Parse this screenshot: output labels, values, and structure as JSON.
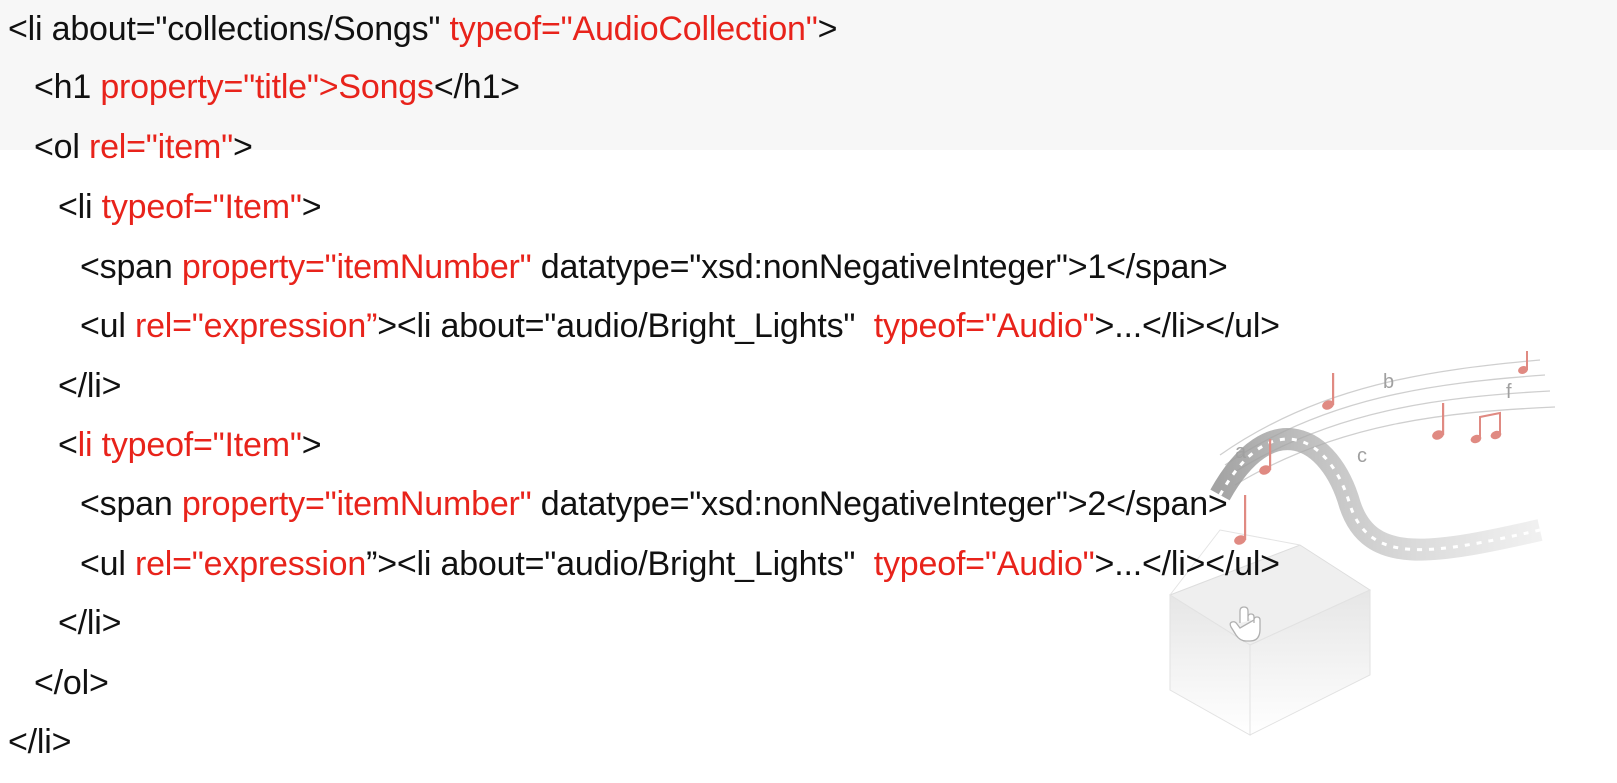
{
  "colors": {
    "text": "#111111",
    "accent": "#e8231b",
    "header_band": "#f7f7f7"
  },
  "illustration": {
    "icon": "music-film-box-illustration",
    "letters": [
      "b",
      "f",
      "a",
      "c"
    ]
  },
  "code_lines": [
    {
      "indent": 0,
      "segments": [
        {
          "text": "<li about=\"collections/Songs\" ",
          "accent": false
        },
        {
          "text": "typeof=\"AudioCollection\"",
          "accent": true
        },
        {
          "text": ">",
          "accent": false
        }
      ]
    },
    {
      "indent": 1,
      "segments": [
        {
          "text": "<h1 ",
          "accent": false
        },
        {
          "text": "property=\"title\">Songs",
          "accent": true
        },
        {
          "text": "</h1>",
          "accent": false
        }
      ]
    },
    {
      "indent": 1,
      "segments": [
        {
          "text": "<ol ",
          "accent": false
        },
        {
          "text": "rel=\"item\"",
          "accent": true
        },
        {
          "text": ">",
          "accent": false
        }
      ]
    },
    {
      "indent": 2,
      "segments": [
        {
          "text": "<li ",
          "accent": false
        },
        {
          "text": "typeof=\"Item\"",
          "accent": true
        },
        {
          "text": ">",
          "accent": false
        }
      ]
    },
    {
      "indent": 3,
      "segments": [
        {
          "text": "<span ",
          "accent": false
        },
        {
          "text": "property=\"itemNumber\"",
          "accent": true
        },
        {
          "text": " datatype=\"xsd:nonNegativeInteger\">1</span>",
          "accent": false
        }
      ]
    },
    {
      "indent": 3,
      "segments": [
        {
          "text": "<ul ",
          "accent": false
        },
        {
          "text": "rel=\"expression”",
          "accent": true
        },
        {
          "text": "><li about=\"audio/Bright_Lights\"  ",
          "accent": false
        },
        {
          "text": "typeof=\"Audio\"",
          "accent": true
        },
        {
          "text": ">...</li></ul>",
          "accent": false
        }
      ]
    },
    {
      "indent": 2,
      "segments": [
        {
          "text": "</li>",
          "accent": false
        }
      ]
    },
    {
      "indent": 2,
      "segments": [
        {
          "text": "<",
          "accent": false
        },
        {
          "text": "li typeof=\"Item\"",
          "accent": true
        },
        {
          "text": ">",
          "accent": false
        }
      ]
    },
    {
      "indent": 3,
      "segments": [
        {
          "text": "<span ",
          "accent": false
        },
        {
          "text": "property=\"itemNumber\"",
          "accent": true
        },
        {
          "text": " datatype=\"xsd:nonNegativeInteger\">2</span>",
          "accent": false
        }
      ]
    },
    {
      "indent": 3,
      "segments": [
        {
          "text": "<ul ",
          "accent": false
        },
        {
          "text": "rel=\"expression",
          "accent": true
        },
        {
          "text": "”><li about=\"audio/Bright_Lights\"  ",
          "accent": false
        },
        {
          "text": "typeof=\"Audio\"",
          "accent": true
        },
        {
          "text": ">...</li></ul>",
          "accent": false
        }
      ]
    },
    {
      "indent": 2,
      "segments": [
        {
          "text": "</li>",
          "accent": false
        }
      ]
    },
    {
      "indent": 1,
      "segments": [
        {
          "text": "</ol>",
          "accent": false
        }
      ]
    },
    {
      "indent": 0,
      "segments": [
        {
          "text": "</li>",
          "accent": false
        }
      ]
    }
  ]
}
